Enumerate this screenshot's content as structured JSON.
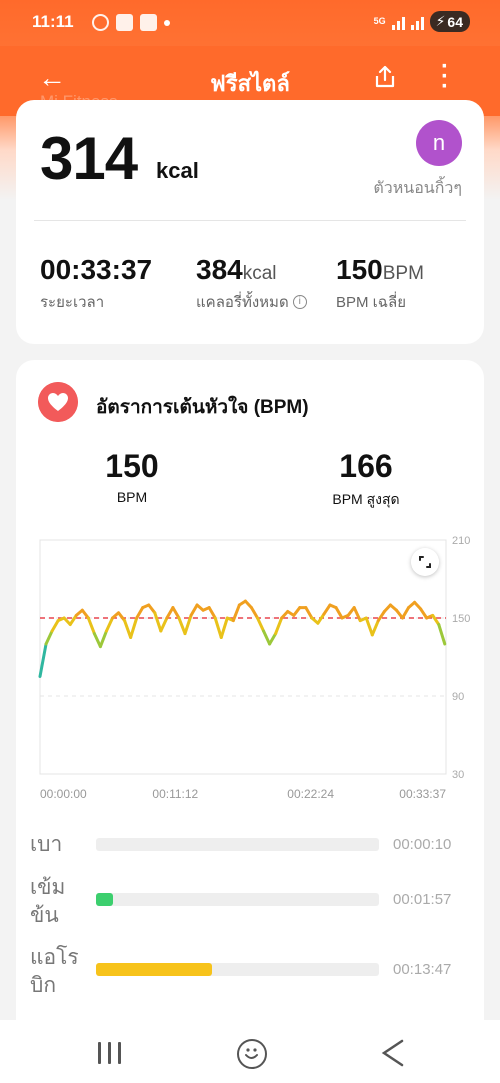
{
  "status_bar": {
    "time": "11:11",
    "network": "5G",
    "battery": "64"
  },
  "header": {
    "title": "ฟรีสไตล์",
    "ghost_text": "Mi Fitness"
  },
  "summary": {
    "calories_value": "314",
    "calories_unit": "kcal",
    "avatar_letter": "n",
    "username": "ตัวหนอนกิ้วๆ",
    "duration_value": "00:33:37",
    "duration_label": "ระยะเวลา",
    "total_cal_value": "384",
    "total_cal_unit": "kcal",
    "total_cal_label": "แคลอรี่ทั้งหมด",
    "avg_bpm_value": "150",
    "avg_bpm_unit": "BPM",
    "avg_bpm_label": "BPM เฉลี่ย"
  },
  "heart_rate": {
    "title": "อัตราการเต้นหัวใจ (BPM)",
    "avg_value": "150",
    "avg_label": "BPM",
    "max_value": "166",
    "max_label": "BPM สูงสุด"
  },
  "zones": [
    {
      "name_lines": [
        "เบา"
      ],
      "duration": "00:00:10",
      "fraction": 0.0,
      "color": "#3ccf6e"
    },
    {
      "name_lines": [
        "เข้ม",
        "ข้น"
      ],
      "duration": "00:01:57",
      "fraction": 0.06,
      "color": "#3ccf6e"
    },
    {
      "name_lines": [
        "แอโร",
        "บิก"
      ],
      "duration": "00:13:47",
      "fraction": 0.41,
      "color": "#f7c31b"
    }
  ],
  "colors": {
    "accent": "#ff6a2b",
    "heart": "#f25a5a",
    "avatar": "#b152cc",
    "avg_line": "#e8454f"
  },
  "chart_data": {
    "type": "line",
    "x_tick_labels": [
      "00:00:00",
      "00:11:12",
      "00:22:24",
      "00:33:37"
    ],
    "y_ticks": [
      210,
      150,
      90,
      30
    ],
    "ylim": [
      30,
      210
    ],
    "xlim_minutes": [
      0,
      33.6
    ],
    "avg_line": 150,
    "grid": true,
    "series": [
      {
        "x": [
          0,
          0.5,
          1,
          1.5,
          2,
          2.5,
          3,
          3.5,
          4,
          4.5,
          5,
          5.5,
          6,
          6.5,
          7,
          7.5,
          8,
          8.5,
          9,
          9.5,
          10,
          10.5,
          11,
          11.5,
          12,
          12.5,
          13,
          13.5,
          14,
          14.5,
          15,
          15.5,
          16,
          16.5,
          17,
          17.5,
          18,
          18.5,
          19,
          19.5,
          20,
          20.5,
          21,
          21.5,
          22,
          22.5,
          23,
          23.5,
          24,
          24.5,
          25,
          25.5,
          26,
          26.5,
          27,
          27.5,
          28,
          28.5,
          29,
          29.5,
          30,
          30.5,
          31,
          31.5,
          32,
          32.5,
          33,
          33.5
        ],
        "y": [
          105,
          130,
          140,
          148,
          150,
          145,
          152,
          156,
          150,
          138,
          128,
          140,
          150,
          154,
          148,
          135,
          150,
          158,
          160,
          154,
          140,
          150,
          158,
          150,
          138,
          152,
          160,
          156,
          158,
          150,
          135,
          150,
          148,
          160,
          163,
          158,
          150,
          140,
          130,
          138,
          150,
          155,
          152,
          158,
          158,
          150,
          146,
          153,
          160,
          158,
          150,
          152,
          158,
          148,
          150,
          137,
          148,
          155,
          160,
          156,
          150,
          158,
          162,
          157,
          150,
          152,
          145,
          130
        ]
      }
    ]
  }
}
